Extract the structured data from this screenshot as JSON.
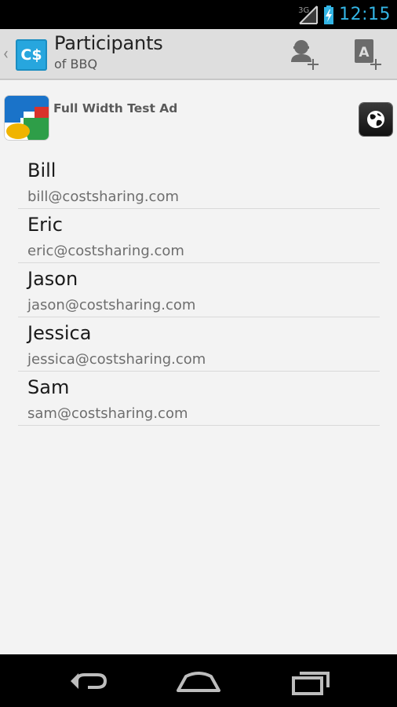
{
  "status_bar": {
    "network": "3G",
    "time": "12:15"
  },
  "action_bar": {
    "app_icon_text": "C$",
    "title": "Participants",
    "subtitle": "of BBQ",
    "add_participant_icon": "add-person-icon",
    "add_from_contacts_icon": "add-contact-icon"
  },
  "ad": {
    "text": "Full Width Test Ad"
  },
  "participants": [
    {
      "name": "Bill",
      "email": "bill@costsharing.com"
    },
    {
      "name": "Eric",
      "email": "eric@costsharing.com"
    },
    {
      "name": "Jason",
      "email": "jason@costsharing.com"
    },
    {
      "name": "Jessica",
      "email": "jessica@costsharing.com"
    },
    {
      "name": "Sam",
      "email": "sam@costsharing.com"
    }
  ],
  "colors": {
    "accent": "#33b5e5",
    "app_icon": "#27a6de",
    "action_bar_bg": "#dedede",
    "page_bg": "#f3f3f3"
  }
}
